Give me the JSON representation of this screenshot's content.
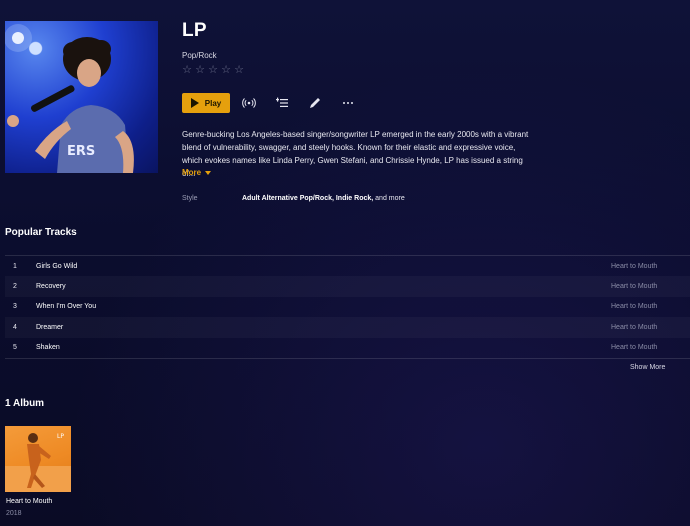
{
  "artist": {
    "name": "LP",
    "genre": "Pop/Rock",
    "rating_stars": 5,
    "bio": "Genre-bucking Los Angeles-based singer/songwriter LP emerged in the early 2000s with a vibrant blend of vulnerability, swagger, and steely hooks. Known for their elastic and expressive voice, which evokes names like Linda Perry, Gwen Stefani, and Chrissie Hynde, LP has issued a string of...",
    "more_label": "More",
    "style_label": "Style",
    "style_value_bold": "Adult Alternative Pop/Rock, Indie Rock,",
    "style_value_rest": " and more"
  },
  "actions": {
    "play_label": "Play",
    "icons": [
      "radio-icon",
      "add-to-playlist-icon",
      "edit-icon",
      "more-options-icon"
    ]
  },
  "popular_tracks": {
    "title": "Popular Tracks",
    "tracks": [
      {
        "num": "1",
        "name": "Girls Go Wild",
        "album": "Heart to Mouth"
      },
      {
        "num": "2",
        "name": "Recovery",
        "album": "Heart to Mouth"
      },
      {
        "num": "3",
        "name": "When I'm Over You",
        "album": "Heart to Mouth"
      },
      {
        "num": "4",
        "name": "Dreamer",
        "album": "Heart to Mouth"
      },
      {
        "num": "5",
        "name": "Shaken",
        "album": "Heart to Mouth"
      }
    ],
    "show_more_label": "Show More"
  },
  "albums": {
    "title": "1 Album",
    "items": [
      {
        "name": "Heart to Mouth",
        "year": "2018"
      }
    ]
  },
  "colors": {
    "accent": "#e5a00d",
    "background": "#0d1033",
    "muted_text": "#8a8ca6"
  }
}
